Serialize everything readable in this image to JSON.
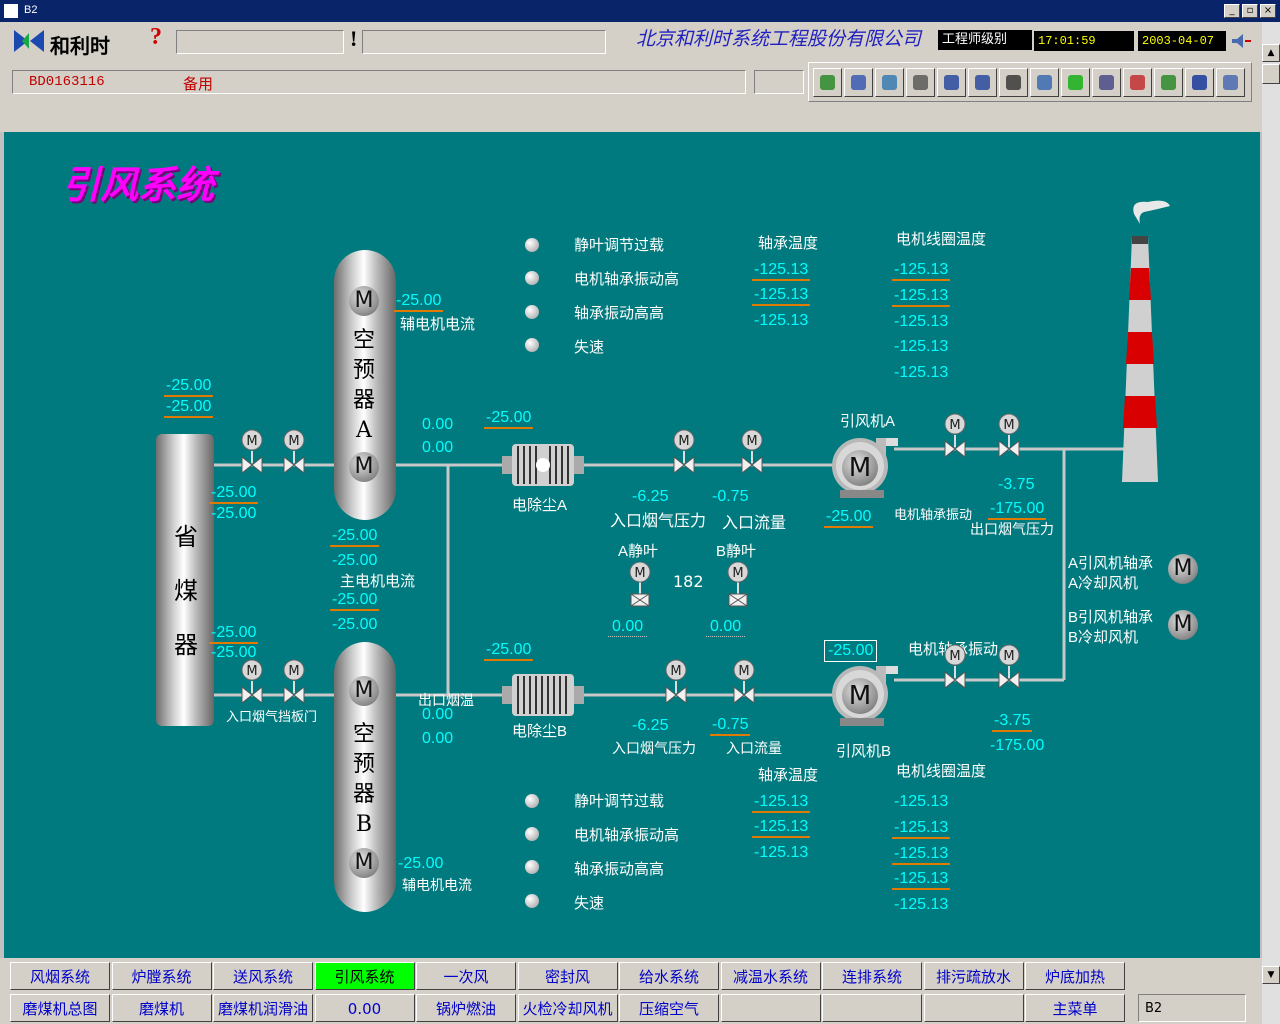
{
  "window": {
    "title": "B2",
    "min": "_",
    "max": "▫",
    "close": "×"
  },
  "header": {
    "company": "北京和利时系统工程股份有限公司",
    "level": "工程师级别",
    "time": "17:01:59",
    "date": "2003-04-07",
    "help": "?",
    "alarm": "!",
    "tag_code": "BD0163116",
    "tag_desc": "备用",
    "toolbar_icons": [
      "globe-check-icon",
      "home-icon",
      "device-icon",
      "back-arrow-icon",
      "copy-left-icon",
      "copy-right-icon",
      "pages-icon",
      "clock-icon",
      "green-status-icon",
      "printer-icon",
      "printer-cancel-icon",
      "printer-check-icon",
      "trend-chart-icon",
      "list-icon"
    ]
  },
  "page": {
    "title": "引风系统"
  },
  "top_status": {
    "lamps": [
      "静叶调节过载",
      "电机轴承振动高",
      "轴承振动高高",
      "失速"
    ],
    "bearing_temp_label": "轴承温度",
    "bearing_temps": [
      "-125.13",
      "-125.13",
      "-125.13"
    ],
    "coil_temp_label": "电机线圈温度",
    "coil_temps": [
      "-125.13",
      "-125.13",
      "-125.13",
      "-125.13",
      "-125.13"
    ]
  },
  "bottom_status": {
    "lamps": [
      "静叶调节过载",
      "电机轴承振动高",
      "轴承振动高高",
      "失速"
    ],
    "bearing_temp_label": "轴承温度",
    "bearing_temps": [
      "-125.13",
      "-125.13",
      "-125.13"
    ],
    "coil_temp_label": "电机线圈温度",
    "coil_temps": [
      "-125.13",
      "-125.13",
      "-125.13",
      "-125.13",
      "-125.13"
    ]
  },
  "equipment": {
    "economizer": "省煤器",
    "aph_a": [
      "空",
      "预",
      "器",
      "A"
    ],
    "aph_b": [
      "空",
      "预",
      "器",
      "B"
    ],
    "motor_letter": "M",
    "esp_a": "电除尘A",
    "esp_b": "电除尘B",
    "fan_a": "引风机A",
    "fan_b": "引风机B"
  },
  "values": {
    "econ_top1": "-25.00",
    "econ_top2": "-25.00",
    "econ_a1": "-25.00",
    "econ_a2": "-25.00",
    "econ_b1": "-25.00",
    "econ_b2": "-25.00",
    "aux_a_val": "-25.00",
    "aux_a_label": "辅电机电流",
    "aux_b_val": "-25.00",
    "aux_b_label": "辅电机电流",
    "main_a1": "-25.00",
    "main_a2": "-25.00",
    "main_label": "主电机电流",
    "main_b1": "-25.00",
    "main_b2": "-25.00",
    "outtemp_a1": "0.00",
    "outtemp_a2": "0.00",
    "outtemp_label": "出口烟温",
    "outtemp_b1": "0.00",
    "outtemp_b2": "0.00",
    "esp_a_val": "-25.00",
    "esp_b_val": "-25.00",
    "inpress_a": "-6.25",
    "inpress_a_label": "入口烟气压力",
    "inflow_a": "-0.75",
    "inflow_a_label": "入口流量",
    "inpress_b": "-6.25",
    "inpress_b_label": "入口烟气压力",
    "inflow_b": "-0.75",
    "inflow_b_label": "入口流量",
    "fan_a_val": "-25.00",
    "fan_b_val": "-25.00",
    "vib_a_label": "电机轴承振动",
    "vib_b_label": "电机轴承振动",
    "outpress_a1": "-3.75",
    "outpress_a2": "-175.00",
    "outpress_a_label": "出口烟气压力",
    "outpress_b1": "-3.75",
    "outpress_b2": "-175.00",
    "vane_a_label": "A静叶",
    "vane_b_label": "B静叶",
    "vane_mid": "182",
    "vane_a_val": "0.00",
    "vane_b_val": "0.00",
    "damper_label": "入口烟气挡板门",
    "cool_a_label": "A引风机轴承A冷却风机",
    "cool_b_label": "B引风机轴承B冷却风机"
  },
  "nav_row1": [
    "风烟系统",
    "炉膛系统",
    "送风系统",
    "引风系统",
    "一次风",
    "密封风",
    "给水系统",
    "减温水系统",
    "连排系统",
    "排污疏放水",
    "炉底加热"
  ],
  "nav_row2": [
    "磨煤机总图",
    "磨煤机",
    "磨煤机润滑油",
    "0.00",
    "锅炉燃油",
    "火检冷却风机",
    "压缩空气",
    "",
    "",
    "",
    "主菜单",
    "B2"
  ],
  "colors": {
    "canvas": "#007a7e",
    "value": "#00ffff",
    "title": "#ff00ff",
    "active_tab": "#00ff00",
    "underline": "#e07a00"
  }
}
